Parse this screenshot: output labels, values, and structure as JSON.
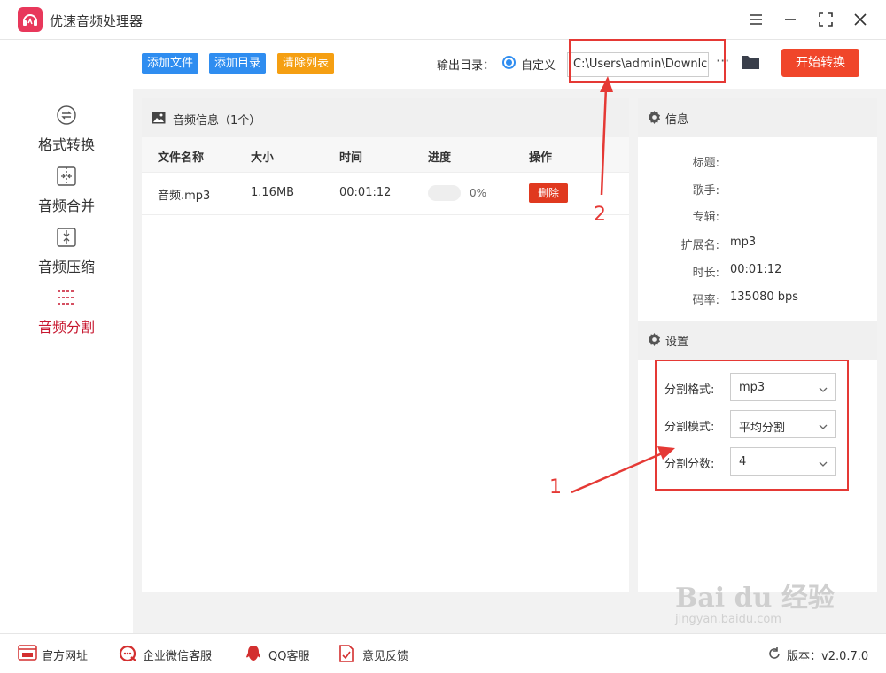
{
  "app": {
    "title": "优速音频处理器"
  },
  "sidebar": {
    "items": [
      {
        "label": "格式转换",
        "icon": "format-convert-icon",
        "active": false
      },
      {
        "label": "音频合并",
        "icon": "merge-icon",
        "active": false
      },
      {
        "label": "音频压缩",
        "icon": "compress-icon",
        "active": false
      },
      {
        "label": "音频分割",
        "icon": "split-icon",
        "active": true
      }
    ]
  },
  "toolbar": {
    "add_file": "添加文件",
    "add_folder": "添加目录",
    "clear_list": "清除列表",
    "output_label": "输出目录：",
    "radio_label": "自定义",
    "path_value": "C:\\Users\\admin\\Downlc",
    "more": "···",
    "start": "开始转换"
  },
  "audio_panel": {
    "title": "音频信息（1个）",
    "columns": [
      "文件名称",
      "大小",
      "时间",
      "进度",
      "操作"
    ],
    "rows": [
      {
        "name": "音频.mp3",
        "size": "1.16MB",
        "time": "00:01:12",
        "progress": 0,
        "progress_text": "0%",
        "action": "删除"
      }
    ]
  },
  "info_panel": {
    "title": "信息",
    "fields": [
      {
        "label": "标题:",
        "value": ""
      },
      {
        "label": "歌手:",
        "value": ""
      },
      {
        "label": "专辑:",
        "value": ""
      },
      {
        "label": "扩展名:",
        "value": "mp3"
      },
      {
        "label": "时长:",
        "value": "00:01:12"
      },
      {
        "label": "码率:",
        "value": "135080 bps"
      }
    ]
  },
  "settings_panel": {
    "title": "设置",
    "fields": [
      {
        "label": "分割格式:",
        "value": "mp3"
      },
      {
        "label": "分割模式:",
        "value": "平均分割"
      },
      {
        "label": "分割分数:",
        "value": "4"
      }
    ]
  },
  "annotations": {
    "one": "1",
    "two": "2"
  },
  "bottom": {
    "links": [
      {
        "label": "官方网址",
        "icon": "website-icon"
      },
      {
        "label": "企业微信客服",
        "icon": "wechat-service-icon"
      },
      {
        "label": "QQ客服",
        "icon": "qq-icon"
      },
      {
        "label": "意见反馈",
        "icon": "feedback-icon"
      }
    ],
    "version": "版本：v2.0.7.0"
  },
  "watermark": {
    "main": "Bai du 经验",
    "sub": "jingyan.baidu.com"
  },
  "colors": {
    "accent_red": "#c7172f",
    "blue": "#2f8df0",
    "orange": "#f59f12",
    "start_red": "#f0462a",
    "annotation_red": "#e53935"
  }
}
